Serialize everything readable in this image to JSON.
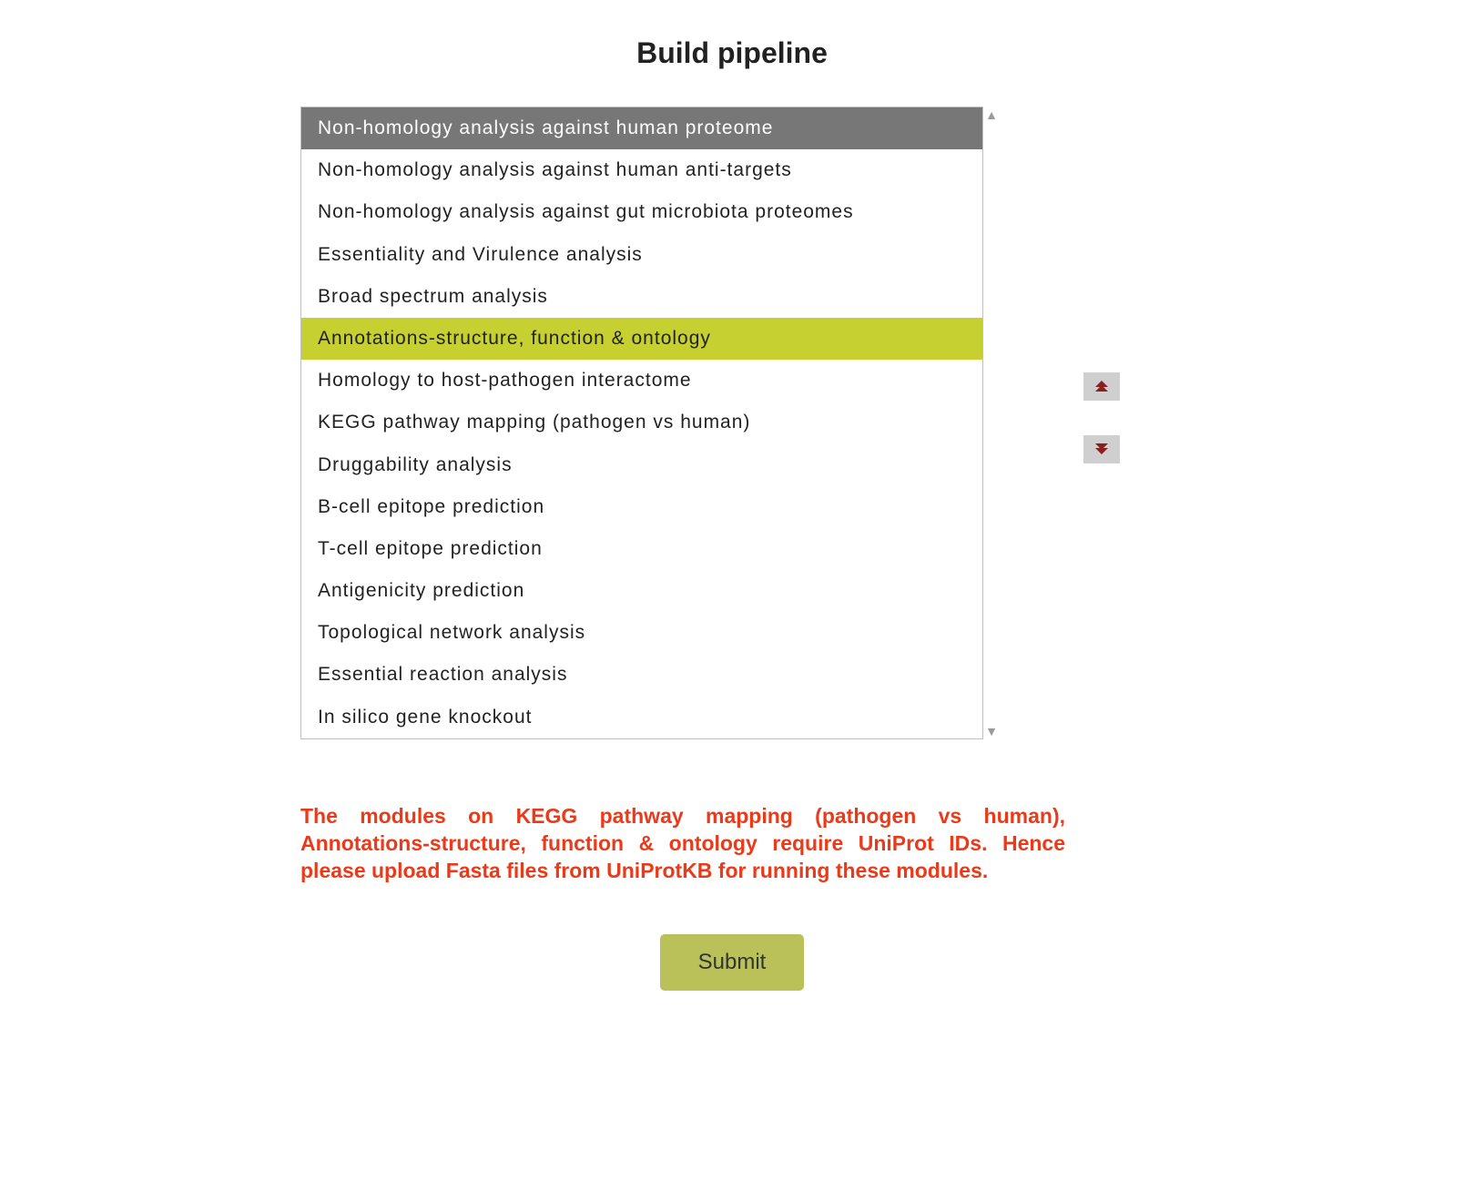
{
  "title": "Build pipeline",
  "list": {
    "items": [
      {
        "label": "Non-homology analysis against human proteome",
        "state": "selected"
      },
      {
        "label": "Non-homology analysis against human anti-targets",
        "state": ""
      },
      {
        "label": "Non-homology analysis against gut microbiota proteomes",
        "state": ""
      },
      {
        "label": "Essentiality and Virulence analysis",
        "state": ""
      },
      {
        "label": "Broad spectrum analysis",
        "state": ""
      },
      {
        "label": "Annotations-structure, function & ontology",
        "state": "highlight"
      },
      {
        "label": "Homology to host-pathogen interactome",
        "state": ""
      },
      {
        "label": "KEGG pathway mapping (pathogen vs human)",
        "state": ""
      },
      {
        "label": "Druggability analysis",
        "state": ""
      },
      {
        "label": "B-cell epitope prediction",
        "state": ""
      },
      {
        "label": "T-cell epitope prediction",
        "state": ""
      },
      {
        "label": "Antigenicity prediction",
        "state": ""
      },
      {
        "label": "Topological network analysis",
        "state": ""
      },
      {
        "label": "Essential reaction analysis",
        "state": ""
      },
      {
        "label": "In silico gene knockout",
        "state": ""
      }
    ]
  },
  "scroll": {
    "up_glyph": "▲",
    "down_glyph": "▼"
  },
  "mover": {
    "up_name": "move-up-button",
    "down_name": "move-down-button"
  },
  "warning_text": "The modules on KEGG pathway mapping (pathogen vs human), Annotations-structure, function & ontology require UniProt IDs. Hence please upload Fasta files from UniProtKB for running these modules.",
  "submit_label": "Submit",
  "colors": {
    "selected_bg": "#777777",
    "highlight_bg": "#c7d031",
    "warning_text": "#eb3a1a",
    "submit_bg": "#b9c158",
    "chevron": "#8b1e1e",
    "mover_bg": "#cfcfcf"
  }
}
